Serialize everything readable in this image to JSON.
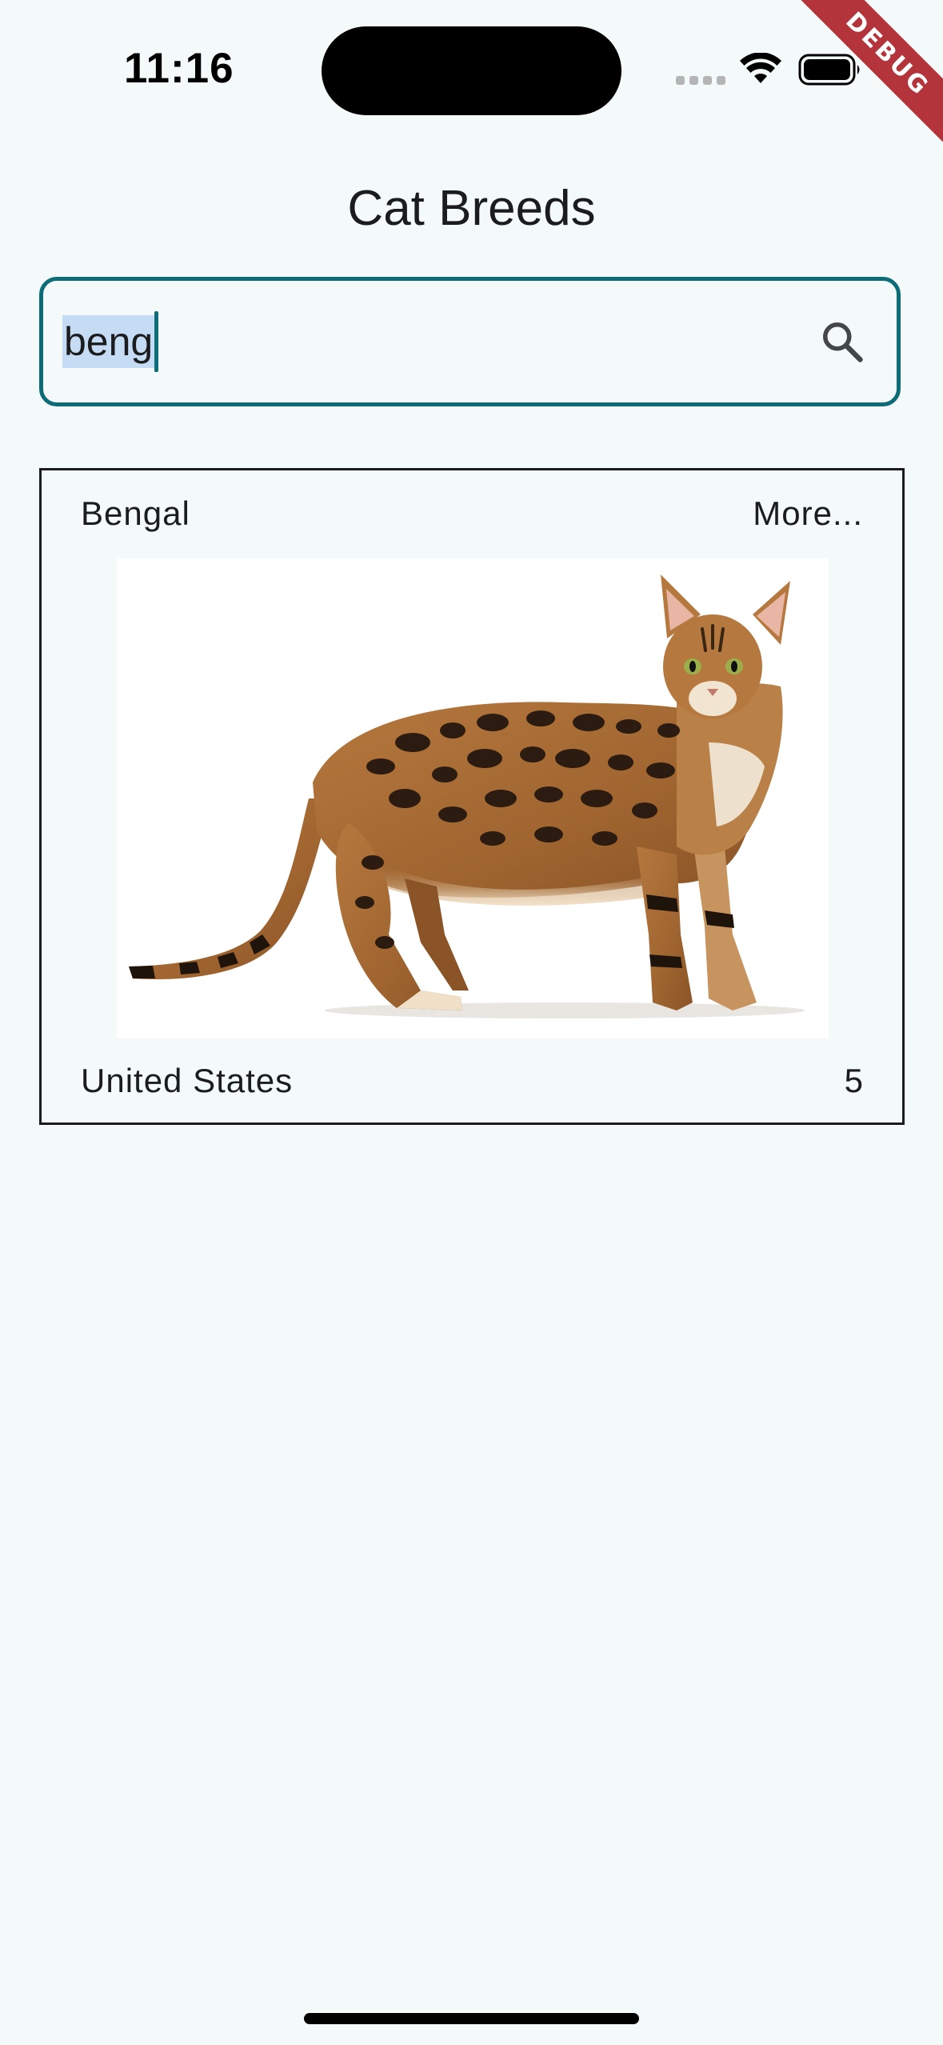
{
  "status_bar": {
    "time": "11:16"
  },
  "debug_banner": {
    "label": "DEBUG",
    "color": "#b3343a"
  },
  "header": {
    "title": "Cat Breeds"
  },
  "search": {
    "value": "beng",
    "icon": "search-icon",
    "border_color": "#0e6b78"
  },
  "results": [
    {
      "name": "Bengal",
      "more_label": "More...",
      "image": "bengal-cat-photo",
      "origin": "United States",
      "count": "5"
    }
  ]
}
